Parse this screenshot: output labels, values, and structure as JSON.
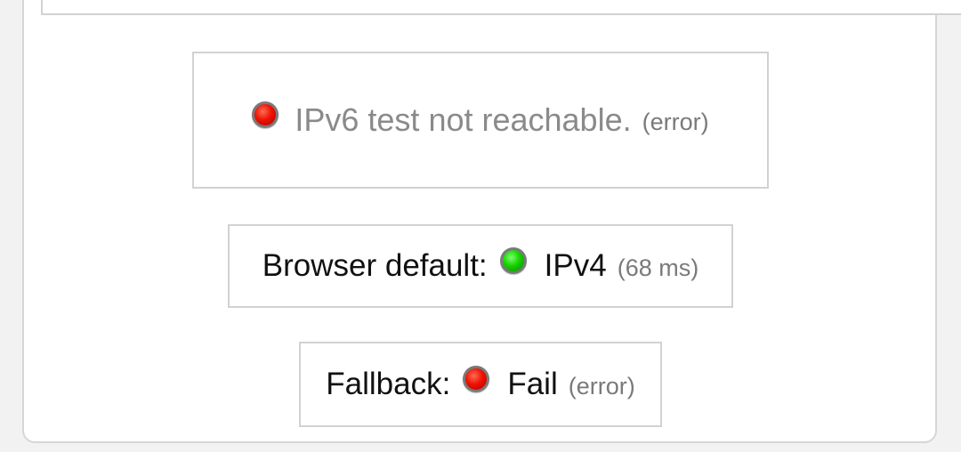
{
  "ipv6_test": {
    "status_color": "#ee1200",
    "icon": "red-led-icon",
    "message": "IPv6 test not reachable.",
    "detail": "(error)"
  },
  "browser_default": {
    "label": "Browser default:",
    "status_color": "#16d100",
    "icon": "green-led-icon",
    "value": "IPv4",
    "detail": "(68 ms)"
  },
  "fallback": {
    "label": "Fallback:",
    "status_color": "#ee1200",
    "icon": "red-led-icon",
    "value": "Fail",
    "detail": "(error)"
  }
}
